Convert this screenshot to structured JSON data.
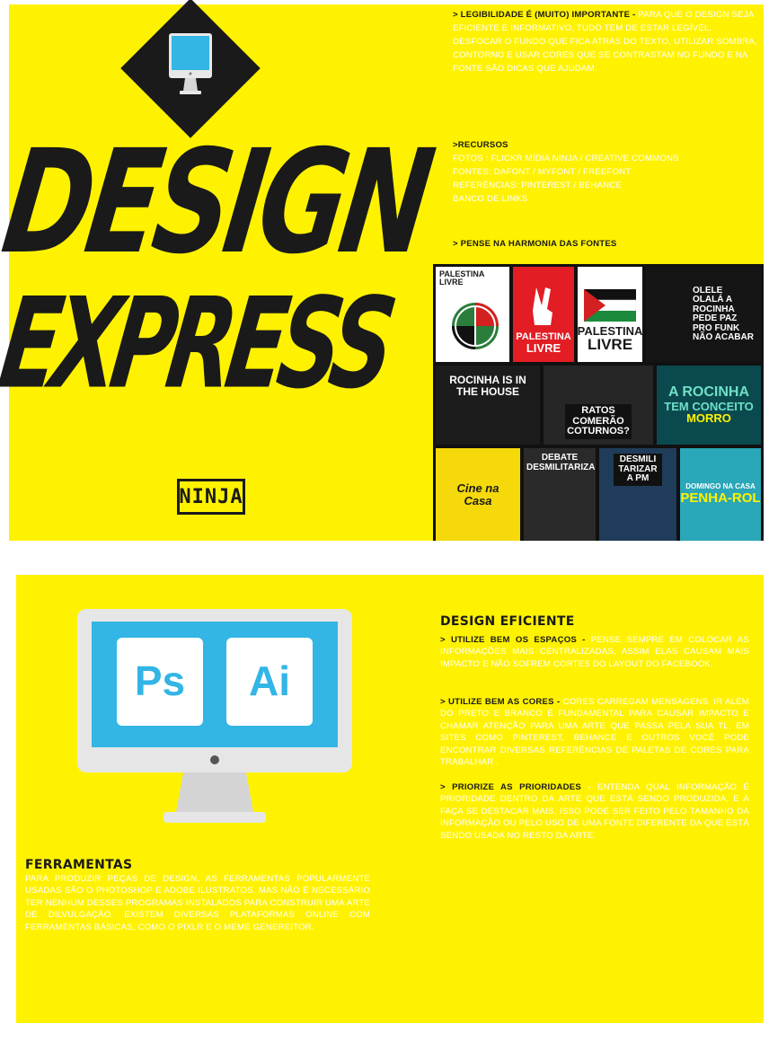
{
  "panel1": {
    "title_line1": "DESIGN",
    "title_line2": "EXPRESS",
    "logo_text": "NINJA",
    "legibility": {
      "heading": "> LEGIBILIDADE É (MUITO)  IMPORTANTE - ",
      "body": "PARA QUE O DESIGN SEJA EFICIENTE E INFORMATIVO, TUDO TEM DE ESTAR LEGÍVEL. DESFOCAR O FUNDO QUE FICA ATRÁS DO TEXTO, UTILIZAR SOMBRA, CONTORNO E USAR CORES QUE SE CONTRASTAM NO FUNDO E NA FONTE SÃO DICAS QUE AJUDAM."
    },
    "resources": {
      "heading": ">RECURSOS",
      "lines": [
        "FOTOS : FLICKR MÍDIA NINJA / CREATIVE COMMONS",
        "FONTES: DAFONT / MYFONT / FREEFONT",
        "REFERÊNCIAS: PINTEREST / BEHANCE",
        "BANCO DE LINKS"
      ]
    },
    "harmony_heading": "> PENSE NA HARMONIA DAS FONTES",
    "tiles": {
      "t1": "PALESTINA LIVRE",
      "t2a": "PALESTINA",
      "t2b": "LIVRE",
      "t3a": "PALESTINA",
      "t3b": "LIVRE",
      "t4": "OLELE OLALÁ A ROCINHA PEDE PAZ PRO FUNK NÃO ACABAR",
      "t5": "ROCINHA IS IN THE HOUSE",
      "t6": "RATOS COMERÃO COTURNOS?",
      "t7a": "A ROCINHA",
      "t7b": "TEM CONCEITO",
      "t7c": "MORRO",
      "t8": "Cine na Casa",
      "t9": "DEBATE DESMILITARIZAÇÃO",
      "t10": "DESMILI TARIZAR A PM",
      "t11a": "DOMINGO NA CASA",
      "t11b": "PENHA-ROL"
    }
  },
  "panel2": {
    "ps_label": "Ps",
    "ai_label": "Ai",
    "tools": {
      "heading": "FERRAMENTAS",
      "body": "PARA PRODUZIR PEÇAS DE DESIGN, AS FERRAMENTAS POPULARMENTE USADAS SÃO O PHOTOSHOP E ADOBE ILUSTRATOS. MAS NÃO É NECESSÁRIO TER NENHUM DESSES PROGRAMAS INSTALADOS PARA CONSTRUIR UMA ARTE DE DILVULGAÇÃO. EXISTEM DIVERSAS PLATAFORMAS ONLINE COM FERRAMENTAS BÁSICAS, COMO O PIXLR E O MEME GENEREITOR."
    },
    "design": {
      "heading": "DESIGN EFICIENTE",
      "p1_head": "> UTILIZE BEM OS ESPAÇOS - ",
      "p1_body": "PENSE SEMPRE EM COLOCAR AS INFORMAÇÕES MAIS CENTRALIZADAS, ASSIM ELAS CAUSAM MAIS IMPACTO E NÃO SOFREM CORTES DO LAYOUT DO FACEBOOK.",
      "p2_head": "> UTILIZE BEM AS CORES - ",
      "p2_body": "CORES CARREGAM MENSAGENS. IR ALÉM DO PRETO E BRANCO É FUNDAMENTAL PARA CAUSAR IMPACTO E CHAMAR ATENÇÃO PARA UMA ARTE QUE PASSA PELA SUA TL. EM SITES COMO  PINTEREST, BEHANCE E OUTROS VOCÊ PODE ENCONTRAR DIVERSAS REFERÊNCIAS DE PALETAS DE CORES PARA TRABALHAR .",
      "p3_head": "> PRIORIZE AS PRIORIDADES ",
      "p3_body": "- ENTENDA QUAL INFORMAÇÃO É PRIORIDADE DENTRO DA ARTE QUE ESTÁ SENDO PRODUZIDA, E A FAÇA SE DESTACAR MAIS. ISSO PODE SER FEITO PELO TAMANHO DA INFORMAÇÃO OU PELO USO DE UMA FONTE DIFERENTE DA QUE ESTÁ SENDO USADA NO RESTO DA ARTE."
    }
  },
  "colors": {
    "yellow": "#fff200",
    "dark": "#1a1a1a",
    "screen_blue": "#33b5e5"
  }
}
